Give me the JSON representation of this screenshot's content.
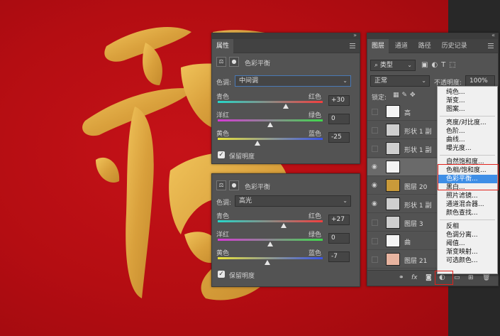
{
  "colors": {
    "canvas": "#b50d12",
    "gold": "#d9a53f",
    "panel": "#535353",
    "highlight": "#3e8ee6",
    "annotation": "#e0221b"
  },
  "props_top": {
    "header": {
      "tab": "属性",
      "adj_title": "色彩平衡"
    },
    "tone_label": "色调:",
    "tone_value": "中间调",
    "sliders": [
      {
        "left": "青色",
        "right": "红色",
        "value": "+30",
        "pos": 0.65
      },
      {
        "left": "洋红",
        "right": "绿色",
        "value": "0",
        "pos": 0.5
      },
      {
        "left": "黄色",
        "right": "蓝色",
        "value": "-25",
        "pos": 0.375
      }
    ],
    "preserve_label": "保留明度",
    "check_mark": "✓"
  },
  "props_bottom": {
    "adj_title": "色彩平衡",
    "tone_label": "色调:",
    "tone_value": "高光",
    "sliders": [
      {
        "left": "青色",
        "right": "红色",
        "value": "+27",
        "pos": 0.63
      },
      {
        "left": "洋红",
        "right": "绿色",
        "value": "0",
        "pos": 0.5
      },
      {
        "left": "黄色",
        "right": "蓝色",
        "value": "-7",
        "pos": 0.47
      }
    ],
    "preserve_label": "保留明度",
    "check_mark": "✓"
  },
  "layers_panel": {
    "tabs": [
      "图层",
      "通道",
      "路径",
      "历史记录"
    ],
    "filter_kind": "类型",
    "blend_mode": "正常",
    "opacity_label": "不透明度:",
    "opacity_value": "100%",
    "lock_label": "锁定:",
    "layers": [
      {
        "name": "高",
        "visible": false
      },
      {
        "name": "形状 1 副",
        "visible": false
      },
      {
        "name": "形状 1 副",
        "visible": false
      },
      {
        "name": "",
        "visible": true
      },
      {
        "name": "图层 20",
        "visible": true
      },
      {
        "name": "形状 1 副",
        "visible": true
      },
      {
        "name": "图层 3",
        "visible": false
      },
      {
        "name": "曲",
        "visible": false
      },
      {
        "name": "图层 21",
        "visible": false
      }
    ],
    "footer_icons": [
      "link-icon",
      "fx-icon",
      "mask-icon",
      "adjustment-icon",
      "group-icon",
      "new-layer-icon",
      "trash-icon"
    ]
  },
  "adjust_menu": {
    "items": [
      "纯色...",
      "渐变...",
      "图案...",
      "亮度/对比度...",
      "色阶...",
      "曲线...",
      "曝光度...",
      "自然饱和度...",
      "色相/饱和度...",
      "色彩平衡...",
      "黑白...",
      "照片滤镜...",
      "通道混合器...",
      "颜色查找...",
      "反相",
      "色调分离...",
      "阈值...",
      "渐变映射...",
      "可选颜色..."
    ],
    "highlighted": "色彩平衡..."
  }
}
